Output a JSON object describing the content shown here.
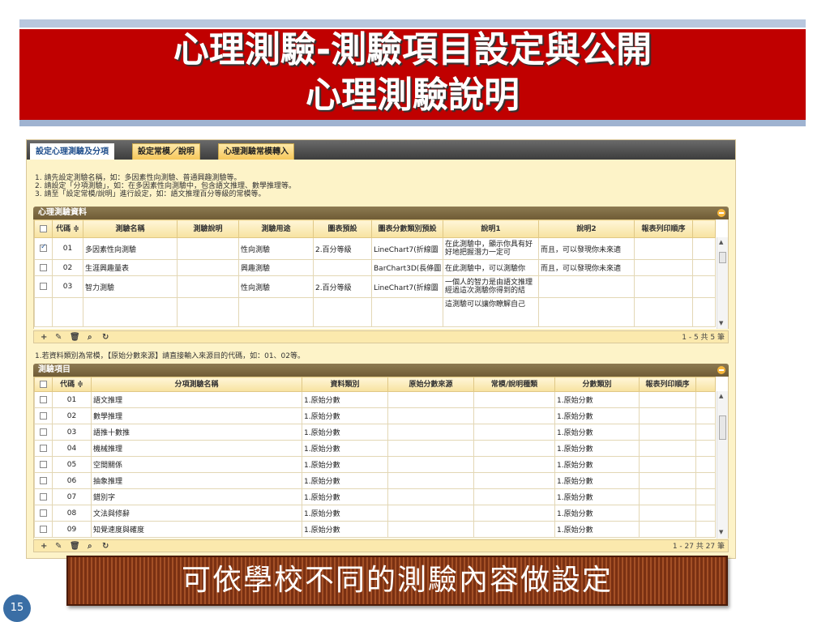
{
  "slide": {
    "title_line1": "心理測驗-測驗項目設定與公開",
    "title_line2": "心理測驗說明",
    "caption": "可依學校不同的測驗內容做設定",
    "page_number": "15"
  },
  "tabs": [
    {
      "label": "設定心理測驗及分項",
      "active": true
    },
    {
      "label": "設定常模／說明",
      "active": false
    },
    {
      "label": "心理測驗常模轉入",
      "active": false
    }
  ],
  "instructions": [
    "1. 請先設定測驗名稱，如：多因素性向測驗、普通興趣測驗等。",
    "2. 請設定「分項測驗」，如：在多因素性向測驗中，包含語文推理、數學推理等。",
    "3. 請至「設定常模/說明」進行設定，如：語文推理百分等級的常模等。"
  ],
  "panel1": {
    "header": "心理測驗資料",
    "columns": [
      "代碼",
      "測驗名稱",
      "測驗說明",
      "測驗用途",
      "圖表預設",
      "圖表分數類別預設",
      "說明1",
      "說明2",
      "報表列印順序"
    ],
    "rows": [
      {
        "checked": true,
        "code": "01",
        "name": "多因素性向測驗",
        "desc": "",
        "usage": "性向測驗",
        "chart": "2.百分等級",
        "chart_type": "LineChart7(折線圖",
        "note1": "在此測驗中，顯示你具有好好地把握潛力一定可",
        "note2": "而且，可以發現你未來適",
        "order": ""
      },
      {
        "checked": false,
        "code": "02",
        "name": "生涯興趣量表",
        "desc": "",
        "usage": "興趣測驗",
        "chart": "",
        "chart_type": "BarChart3D(長條圖",
        "note1": "在此測驗中，可以測驗你",
        "note2": "而且，可以發現你未來適",
        "order": ""
      },
      {
        "checked": false,
        "code": "03",
        "name": "智力測驗",
        "desc": "",
        "usage": "性向測驗",
        "chart": "2.百分等級",
        "chart_type": "LineChart7(折線圖",
        "note1": "一個人的智力是由語文推理經過這次測驗你得到的結",
        "note2": "",
        "order": ""
      }
    ],
    "extra_note": "這測驗可以讓你瞭解自己",
    "pager": "1 - 5  共 5 筆"
  },
  "note_between": "1.若資料類別為常模，【原始分數來源】請直接輸入來源目的代碼，如：01、02等。",
  "panel2": {
    "header": "測驗項目",
    "columns": [
      "代碼",
      "分項測驗名稱",
      "資料類別",
      "原始分數來源",
      "常模/說明種類",
      "分數類別",
      "報表列印順序"
    ],
    "rows": [
      {
        "code": "01",
        "name": "語文推理",
        "type": "1.原始分數",
        "source": "",
        "norm": "",
        "score": "1.原始分數",
        "order": ""
      },
      {
        "code": "02",
        "name": "數學推理",
        "type": "1.原始分數",
        "source": "",
        "norm": "",
        "score": "1.原始分數",
        "order": ""
      },
      {
        "code": "03",
        "name": "語推十數推",
        "type": "1.原始分數",
        "source": "",
        "norm": "",
        "score": "1.原始分數",
        "order": ""
      },
      {
        "code": "04",
        "name": "機械推理",
        "type": "1.原始分數",
        "source": "",
        "norm": "",
        "score": "1.原始分數",
        "order": ""
      },
      {
        "code": "05",
        "name": "空間關係",
        "type": "1.原始分數",
        "source": "",
        "norm": "",
        "score": "1.原始分數",
        "order": ""
      },
      {
        "code": "06",
        "name": "抽象推理",
        "type": "1.原始分數",
        "source": "",
        "norm": "",
        "score": "1.原始分數",
        "order": ""
      },
      {
        "code": "07",
        "name": "錯別字",
        "type": "1.原始分數",
        "source": "",
        "norm": "",
        "score": "1.原始分數",
        "order": ""
      },
      {
        "code": "08",
        "name": "文法與修辭",
        "type": "1.原始分數",
        "source": "",
        "norm": "",
        "score": "1.原始分數",
        "order": ""
      },
      {
        "code": "09",
        "name": "知覺速度與確度",
        "type": "1.原始分數",
        "source": "",
        "norm": "",
        "score": "1.原始分數",
        "order": ""
      }
    ],
    "pager": "1 - 27  共 27 筆"
  },
  "toolbar_icons": [
    "+",
    "✎",
    "🗑",
    "⌕",
    "↻"
  ]
}
